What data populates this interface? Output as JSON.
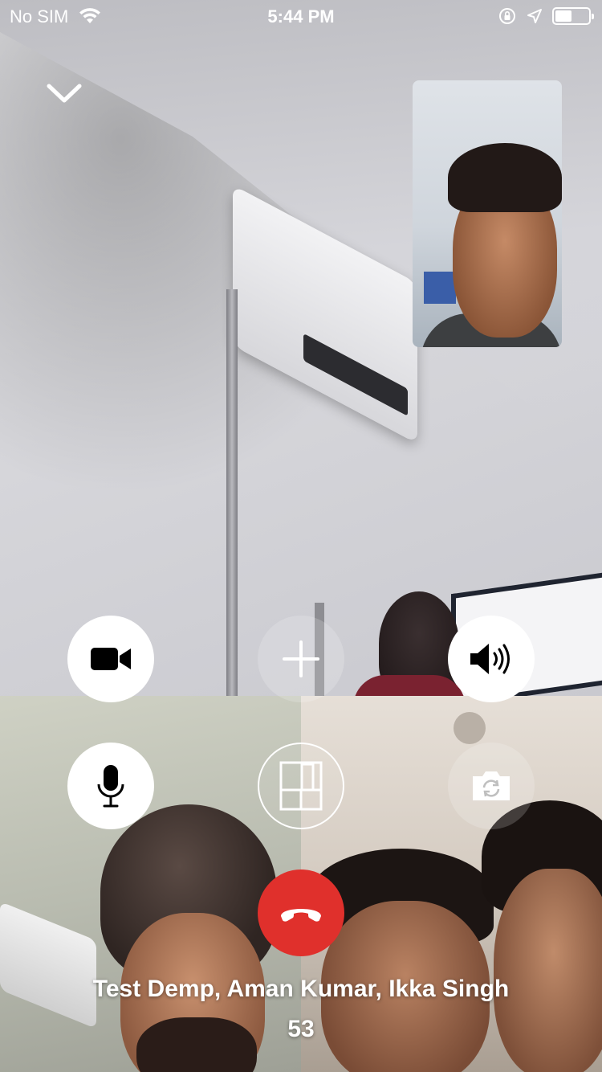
{
  "status_bar": {
    "carrier": "No SIM",
    "time": "5:44 PM",
    "battery_level": 0.5,
    "icons": [
      "wifi-icon",
      "orientation-lock-icon",
      "location-arrow-icon",
      "battery-icon"
    ]
  },
  "controls": {
    "collapse_icon": "chevron-down-icon",
    "video_icon": "video-camera-icon",
    "add_icon": "plus-icon",
    "speaker_icon": "speaker-icon",
    "mic_icon": "microphone-icon",
    "layout_icon": "grid-layout-icon",
    "flip_icon": "flip-camera-icon",
    "end_icon": "end-call-icon"
  },
  "colors": {
    "end_call": "#e0302c",
    "button_light": "#ffffff"
  },
  "call": {
    "participants": "Test Demp, Aman Kumar, Ikka Singh",
    "duration": "53"
  }
}
